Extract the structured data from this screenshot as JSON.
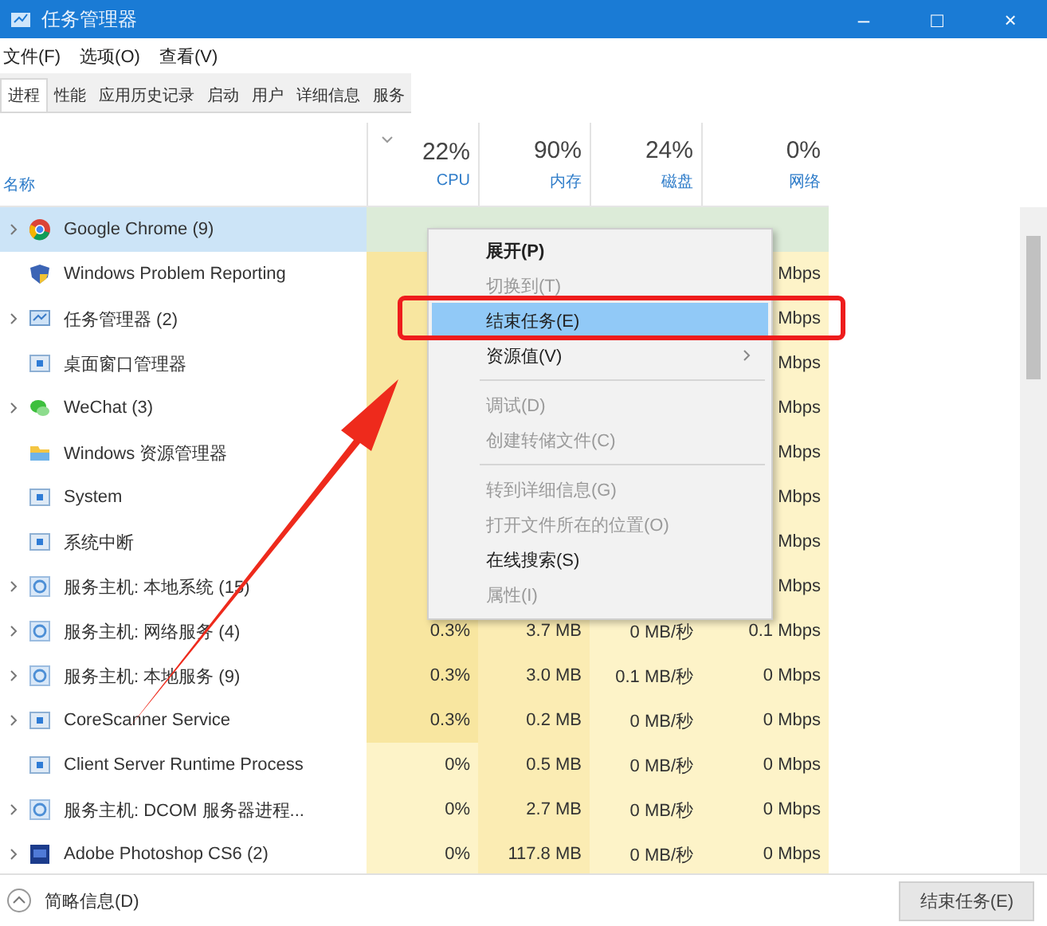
{
  "window": {
    "title": "任务管理器",
    "controls": [
      "–",
      "□",
      "×"
    ]
  },
  "menu": [
    "文件(F)",
    "选项(O)",
    "查看(V)"
  ],
  "tabs": [
    {
      "label": "进程",
      "selected": true
    },
    {
      "label": "性能",
      "selected": false
    },
    {
      "label": "应用历史记录",
      "selected": false
    },
    {
      "label": "启动",
      "selected": false
    },
    {
      "label": "用户",
      "selected": false
    },
    {
      "label": "详细信息",
      "selected": false
    },
    {
      "label": "服务",
      "selected": false
    }
  ],
  "columns": [
    {
      "label": "名称"
    },
    {
      "percent": "22%",
      "label": "CPU",
      "sorted": true
    },
    {
      "percent": "90%",
      "label": "内存"
    },
    {
      "percent": "24%",
      "label": "磁盘"
    },
    {
      "percent": "0%",
      "label": "网络"
    }
  ],
  "rows": [
    {
      "name": "Google Chrome (9)",
      "kind": "chrome",
      "expandable": true,
      "selected": true,
      "cells": [
        "",
        "",
        "",
        ""
      ]
    },
    {
      "name": "Windows Problem Reporting",
      "kind": "shield",
      "expandable": false,
      "selected": false,
      "cells": [
        "",
        "",
        "",
        "Mbps"
      ]
    },
    {
      "name": "任务管理器 (2)",
      "kind": "monitor",
      "expandable": true,
      "selected": false,
      "cells": [
        "",
        "",
        "",
        "Mbps"
      ]
    },
    {
      "name": "桌面窗口管理器",
      "kind": "app",
      "expandable": false,
      "selected": false,
      "cells": [
        "",
        "",
        "",
        "Mbps"
      ]
    },
    {
      "name": "WeChat (3)",
      "kind": "chat",
      "expandable": true,
      "selected": false,
      "cells": [
        "",
        "",
        "",
        "Mbps"
      ]
    },
    {
      "name": "Windows 资源管理器",
      "kind": "folder",
      "expandable": false,
      "selected": false,
      "cells": [
        "",
        "",
        "",
        "Mbps"
      ]
    },
    {
      "name": "System",
      "kind": "app",
      "expandable": false,
      "selected": false,
      "cells": [
        "",
        "",
        "",
        "Mbps"
      ]
    },
    {
      "name": "系统中断",
      "kind": "app",
      "expandable": false,
      "selected": false,
      "cells": [
        "",
        "",
        "",
        "Mbps"
      ]
    },
    {
      "name": "服务主机: 本地系统 (15)",
      "kind": "gear",
      "expandable": true,
      "selected": false,
      "cells": [
        "",
        "",
        "",
        "Mbps"
      ]
    },
    {
      "name": "服务主机: 网络服务 (4)",
      "kind": "gear",
      "expandable": true,
      "selected": false,
      "cells": [
        "0.3%",
        "3.7 MB",
        "0 MB/秒",
        "0.1 Mbps"
      ]
    },
    {
      "name": "服务主机: 本地服务 (9)",
      "kind": "gear",
      "expandable": true,
      "selected": false,
      "cells": [
        "0.3%",
        "3.0 MB",
        "0.1 MB/秒",
        "0 Mbps"
      ]
    },
    {
      "name": "CoreScanner Service",
      "kind": "app",
      "expandable": true,
      "selected": false,
      "cells": [
        "0.3%",
        "0.2 MB",
        "0 MB/秒",
        "0 Mbps"
      ]
    },
    {
      "name": "Client Server Runtime Process",
      "kind": "app",
      "expandable": false,
      "selected": false,
      "cells": [
        "0%",
        "0.5 MB",
        "0 MB/秒",
        "0 Mbps"
      ]
    },
    {
      "name": "服务主机: DCOM 服务器进程...",
      "kind": "gear",
      "expandable": true,
      "selected": false,
      "cells": [
        "0%",
        "2.7 MB",
        "0 MB/秒",
        "0 Mbps"
      ]
    },
    {
      "name": "Adobe Photoshop CS6 (2)",
      "kind": "ps",
      "expandable": true,
      "selected": false,
      "cells": [
        "0%",
        "117.8 MB",
        "0 MB/秒",
        "0 Mbps"
      ]
    }
  ],
  "context_menu": [
    {
      "kind": "item",
      "label": "展开(P)",
      "default": true,
      "disabled": false,
      "selected": false
    },
    {
      "kind": "item",
      "label": "切换到(T)",
      "default": false,
      "disabled": true,
      "selected": false
    },
    {
      "kind": "item",
      "label": "结束任务(E)",
      "default": false,
      "disabled": false,
      "selected": true
    },
    {
      "kind": "item",
      "label": "资源值(V)",
      "default": false,
      "disabled": false,
      "selected": false,
      "submenu": true
    },
    {
      "kind": "separator"
    },
    {
      "kind": "item",
      "label": "调试(D)",
      "default": false,
      "disabled": true,
      "selected": false
    },
    {
      "kind": "item",
      "label": "创建转储文件(C)",
      "default": false,
      "disabled": true,
      "selected": false
    },
    {
      "kind": "separator"
    },
    {
      "kind": "item",
      "label": "转到详细信息(G)",
      "default": false,
      "disabled": true,
      "selected": false
    },
    {
      "kind": "item",
      "label": "打开文件所在的位置(O)",
      "default": false,
      "disabled": true,
      "selected": false
    },
    {
      "kind": "item",
      "label": "在线搜索(S)",
      "default": false,
      "disabled": false,
      "selected": false
    },
    {
      "kind": "item",
      "label": "属性(I)",
      "default": false,
      "disabled": true,
      "selected": false
    }
  ],
  "footer": {
    "toggle": "简略信息(D)",
    "button": "结束任务(E)"
  }
}
